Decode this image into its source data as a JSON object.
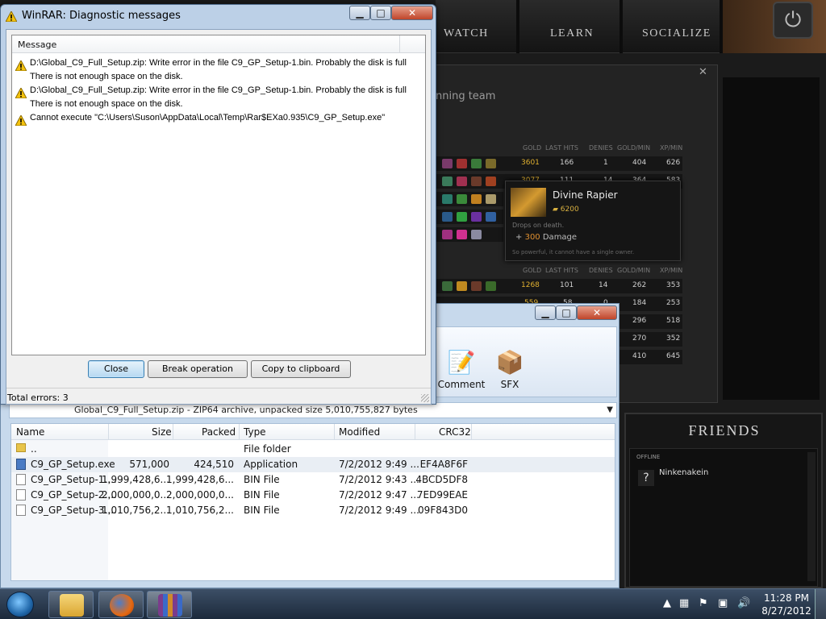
{
  "game": {
    "nav": [
      "WATCH",
      "LEARN",
      "SOCIALIZE"
    ],
    "panel_title": "nning team",
    "headers": [
      "GOLD",
      "LAST HITS",
      "DENIES",
      "GOLD/MIN",
      "XP/MIN"
    ],
    "rows_top": [
      [
        "3601",
        "166",
        "1",
        "404",
        "626"
      ],
      [
        "3077",
        "111",
        "14",
        "364",
        "583"
      ]
    ],
    "rows_bottom": [
      [
        "1268",
        "101",
        "14",
        "262",
        "353"
      ],
      [
        "559",
        "58",
        "0",
        "184",
        "253"
      ],
      [
        "",
        "",
        "",
        "296",
        "518"
      ],
      [
        "",
        "",
        "",
        "270",
        "352"
      ],
      [
        "",
        "",
        "",
        "410",
        "645"
      ]
    ],
    "tooltip": {
      "name": "Divine Rapier",
      "cost": "6200",
      "drops": "Drops on death.",
      "damage_prefix": "+",
      "damage_value": "300",
      "damage_label": "Damage",
      "desc": "So powerful, it cannot have a single owner."
    },
    "friends": {
      "title": "FRIENDS",
      "section": "OFFLINE",
      "name": "Ninkenakein"
    }
  },
  "diagnostic": {
    "title": "WinRAR: Diagnostic messages",
    "column": "Message",
    "lines": [
      {
        "warn": true,
        "text": "D:\\Global_C9_Full_Setup.zip: Write error in the file C9_GP_Setup-1.bin. Probably the disk is full"
      },
      {
        "warn": false,
        "text": "There is not enough space on the disk."
      },
      {
        "warn": true,
        "text": "D:\\Global_C9_Full_Setup.zip: Write error in the file C9_GP_Setup-1.bin. Probably the disk is full"
      },
      {
        "warn": false,
        "text": "There is not enough space on the disk."
      },
      {
        "warn": true,
        "text": "Cannot execute \"C:\\Users\\Suson\\AppData\\Local\\Temp\\Rar$EXa0.935\\C9_GP_Setup.exe\""
      }
    ],
    "buttons": {
      "close": "Close",
      "break": "Break operation",
      "copy": "Copy to clipboard"
    },
    "status": "Total errors: 3"
  },
  "winrar": {
    "toolbar": [
      {
        "label": "Comment",
        "icon": "comment-icon"
      },
      {
        "label": "SFX",
        "icon": "sfx-icon"
      }
    ],
    "path": "Global_C9_Full_Setup.zip - ZIP64 archive, unpacked size 5,010,755,827 bytes",
    "columns": [
      "Name",
      "Size",
      "Packed",
      "Type",
      "Modified",
      "CRC32"
    ],
    "files": [
      {
        "name": "..",
        "size": "",
        "packed": "",
        "type": "File folder",
        "modified": "",
        "crc": "",
        "icon": "folder"
      },
      {
        "name": "C9_GP_Setup.exe",
        "size": "571,000",
        "packed": "424,510",
        "type": "Application",
        "modified": "7/2/2012 9:49 ...",
        "crc": "EF4A8F6F",
        "icon": "exe"
      },
      {
        "name": "C9_GP_Setup-1....",
        "size": "1,999,428,6...",
        "packed": "1,999,428,6...",
        "type": "BIN File",
        "modified": "7/2/2012 9:43 ...",
        "crc": "4BCD5DF8",
        "icon": "file"
      },
      {
        "name": "C9_GP_Setup-2....",
        "size": "2,000,000,0...",
        "packed": "2,000,000,0...",
        "type": "BIN File",
        "modified": "7/2/2012 9:47 ...",
        "crc": "7ED99EAE",
        "icon": "file"
      },
      {
        "name": "C9_GP_Setup-3....",
        "size": "1,010,756,2...",
        "packed": "1,010,756,2...",
        "type": "BIN File",
        "modified": "7/2/2012 9:49 ...",
        "crc": "09F843D0",
        "icon": "file"
      }
    ]
  },
  "taskbar": {
    "time": "11:28 PM",
    "date": "8/27/2012"
  }
}
